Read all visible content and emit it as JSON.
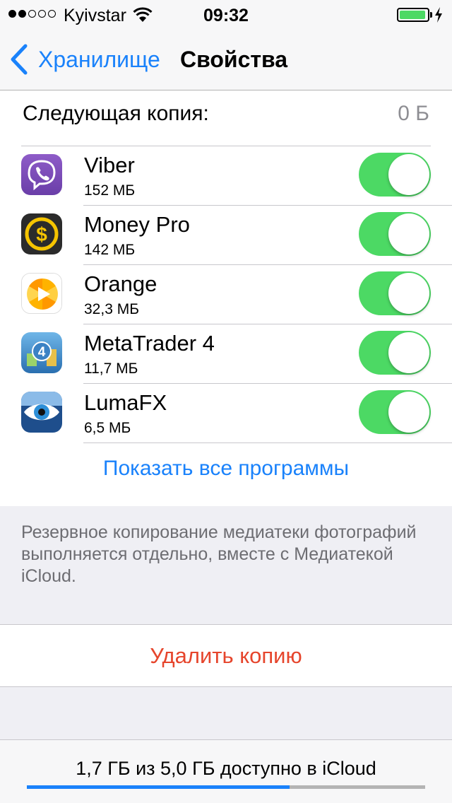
{
  "status_bar": {
    "carrier": "Kyivstar",
    "time": "09:32",
    "signal_bars_filled": 2,
    "signal_bars_total": 5,
    "battery_level": 0.95
  },
  "nav": {
    "back_label": "Хранилище",
    "title": "Свойства"
  },
  "next_backup": {
    "label": "Следующая копия:",
    "value": "0 Б"
  },
  "apps": [
    {
      "name": "Viber",
      "size": "152 МБ",
      "icon": "viber-icon",
      "enabled": true
    },
    {
      "name": "Money Pro",
      "size": "142 МБ",
      "icon": "money-pro-icon",
      "enabled": true
    },
    {
      "name": "Orange",
      "size": "32,3 МБ",
      "icon": "orange-icon",
      "enabled": true
    },
    {
      "name": "MetaTrader 4",
      "size": "11,7 МБ",
      "icon": "metatrader-icon",
      "enabled": true
    },
    {
      "name": "LumaFX",
      "size": "6,5 МБ",
      "icon": "lumafx-icon",
      "enabled": true
    }
  ],
  "show_all_label": "Показать все программы",
  "footer_note": "Резервное копирование медиатеки фотографий выполняется отдельно, вместе с Медиатекой iCloud.",
  "delete_label": "Удалить копию",
  "storage": {
    "text": "1,7 ГБ из 5,0 ГБ доступно в iCloud",
    "used_fraction": 0.66
  },
  "colors": {
    "accent": "#1a82fb",
    "toggle_on": "#4cd964",
    "destructive": "#e6452c",
    "secondary_text": "#8e8e93"
  }
}
